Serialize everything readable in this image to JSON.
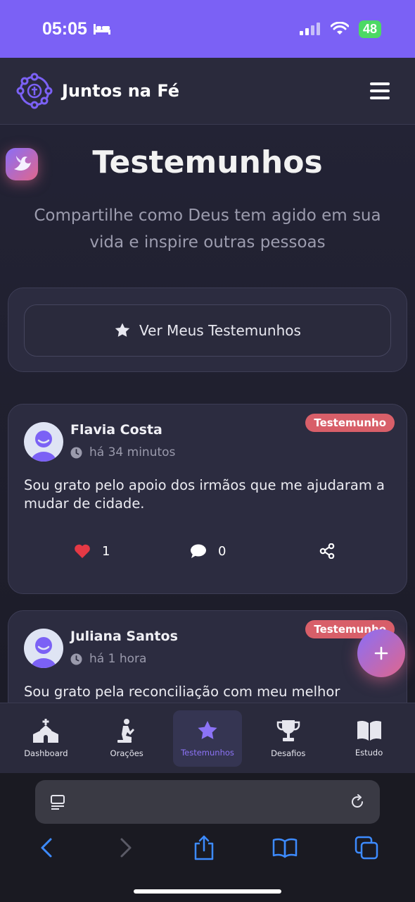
{
  "status": {
    "time": "05:05",
    "battery": "48"
  },
  "header": {
    "title": "Juntos na Fé"
  },
  "page": {
    "title": "Testemunhos",
    "subtitle": "Compartilhe como Deus tem agido em sua vida e inspire outras pessoas"
  },
  "my_testimonies_button": "Ver Meus Testemunhos",
  "posts": [
    {
      "author": "Flavia Costa",
      "time": "há 34 minutos",
      "badge": "Testemunho",
      "text": "Sou grato pelo apoio dos irmãos que me ajudaram a mudar de cidade.",
      "likes": "1",
      "comments": "0"
    },
    {
      "author": "Juliana Santos",
      "time": "há 1 hora",
      "badge": "Testemunho",
      "text": "Sou grato pela reconciliação com meu melhor"
    }
  ],
  "nav": [
    {
      "label": "Dashboard",
      "icon": "church-icon"
    },
    {
      "label": "Orações",
      "icon": "praying-icon"
    },
    {
      "label": "Testemunhos",
      "icon": "star-icon",
      "active": true
    },
    {
      "label": "Desafios",
      "icon": "trophy-icon"
    },
    {
      "label": "Estudo",
      "icon": "book-open-icon"
    }
  ],
  "colors": {
    "accent": "#7b61f5",
    "badge": "#d85f69",
    "like": "#e53945",
    "fab_gradient_start": "#8a6ef7",
    "fab_gradient_end": "#e0668c"
  }
}
